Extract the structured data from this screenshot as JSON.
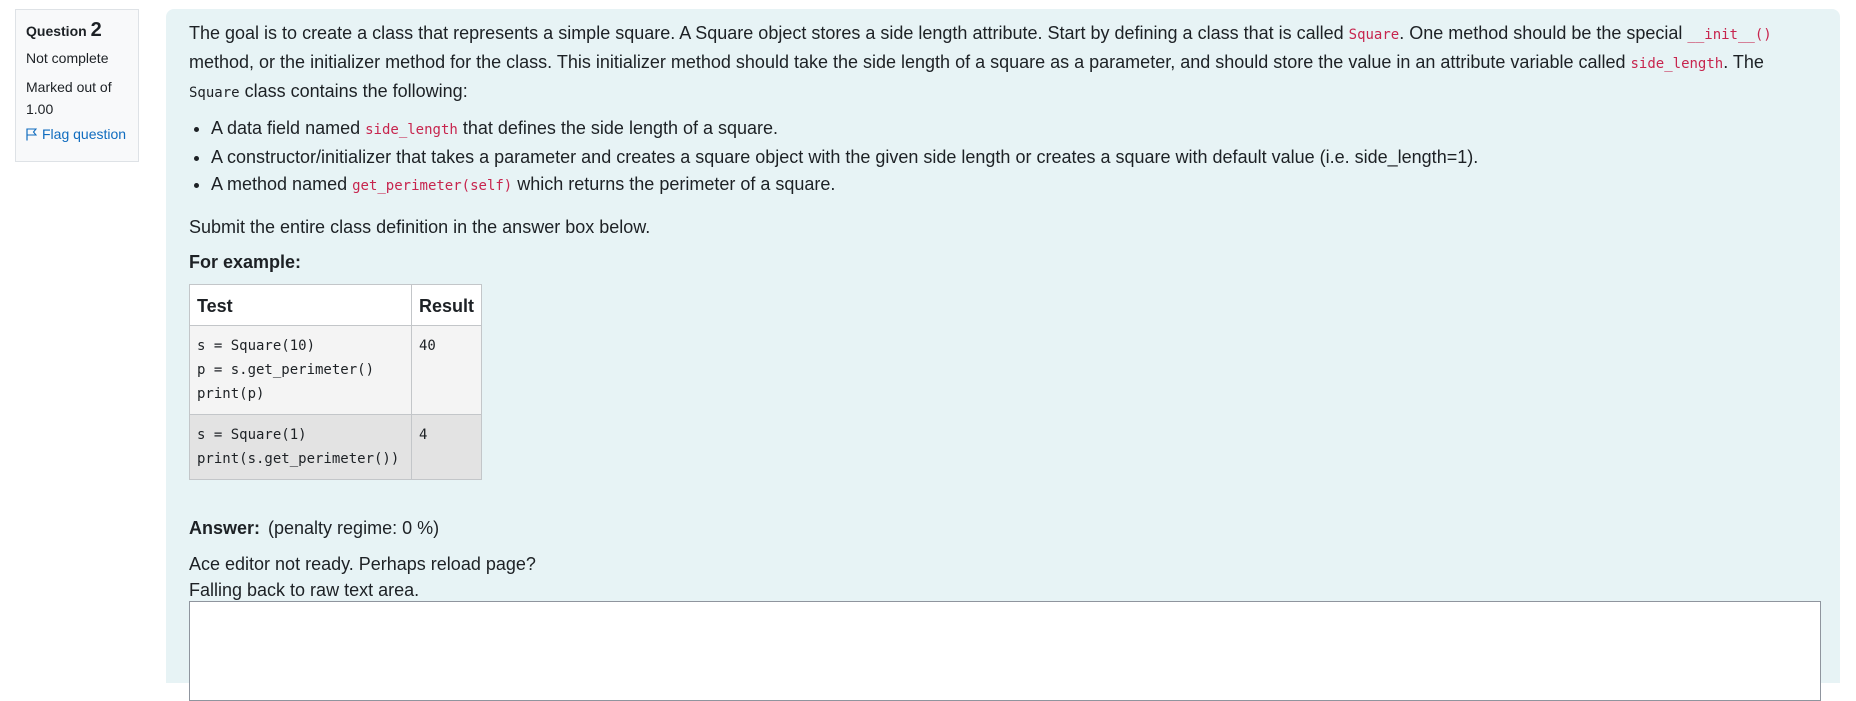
{
  "info": {
    "question_label": "Question",
    "question_number": "2",
    "state": "Not complete",
    "grade_line1": "Marked out of",
    "grade_line2": "1.00",
    "flag_label": "Flag question"
  },
  "qtext": {
    "p1_a": "The goal is to create a class that represents a simple square. A Square object stores a side length attribute. Start by defining a class that is called ",
    "p1_code1": "Square",
    "p1_b": ". One method should be the special ",
    "p1_code2": "__init__()",
    "p1_c": " method, or the initializer method for the class. This initializer method should take the side length of a square as a parameter, and should store the value in an attribute variable called ",
    "p1_code3": "side_length",
    "p1_d": ". The ",
    "p1_code4": "Square",
    "p1_e": " class contains the following:",
    "bullet1_a": "A data field named ",
    "bullet1_code": "side_length",
    "bullet1_b": " that defines the side length of a square.",
    "bullet2": "A constructor/initializer that takes a parameter and creates a square object with the given side length or creates a square with default value (i.e. side_length=1).",
    "bullet3_a": "A method named ",
    "bullet3_code": "get_perimeter(self)",
    "bullet3_b": " which returns the perimeter of a square.",
    "submit": "Submit the entire class definition in the answer box below.",
    "for_example": "For example:"
  },
  "examples": {
    "headers": [
      "Test",
      "Result"
    ],
    "rows": [
      {
        "test": "s = Square(10)\np = s.get_perimeter()\nprint(p)",
        "result": "40"
      },
      {
        "test": "s = Square(1)\nprint(s.get_perimeter())",
        "result": "4"
      }
    ]
  },
  "answer": {
    "label": "Answer:",
    "penalty": "(penalty regime: 0 %)",
    "notready_line1": "Ace editor not ready. Perhaps reload page?",
    "notready_line2": "Falling back to raw text area.",
    "value": ""
  }
}
